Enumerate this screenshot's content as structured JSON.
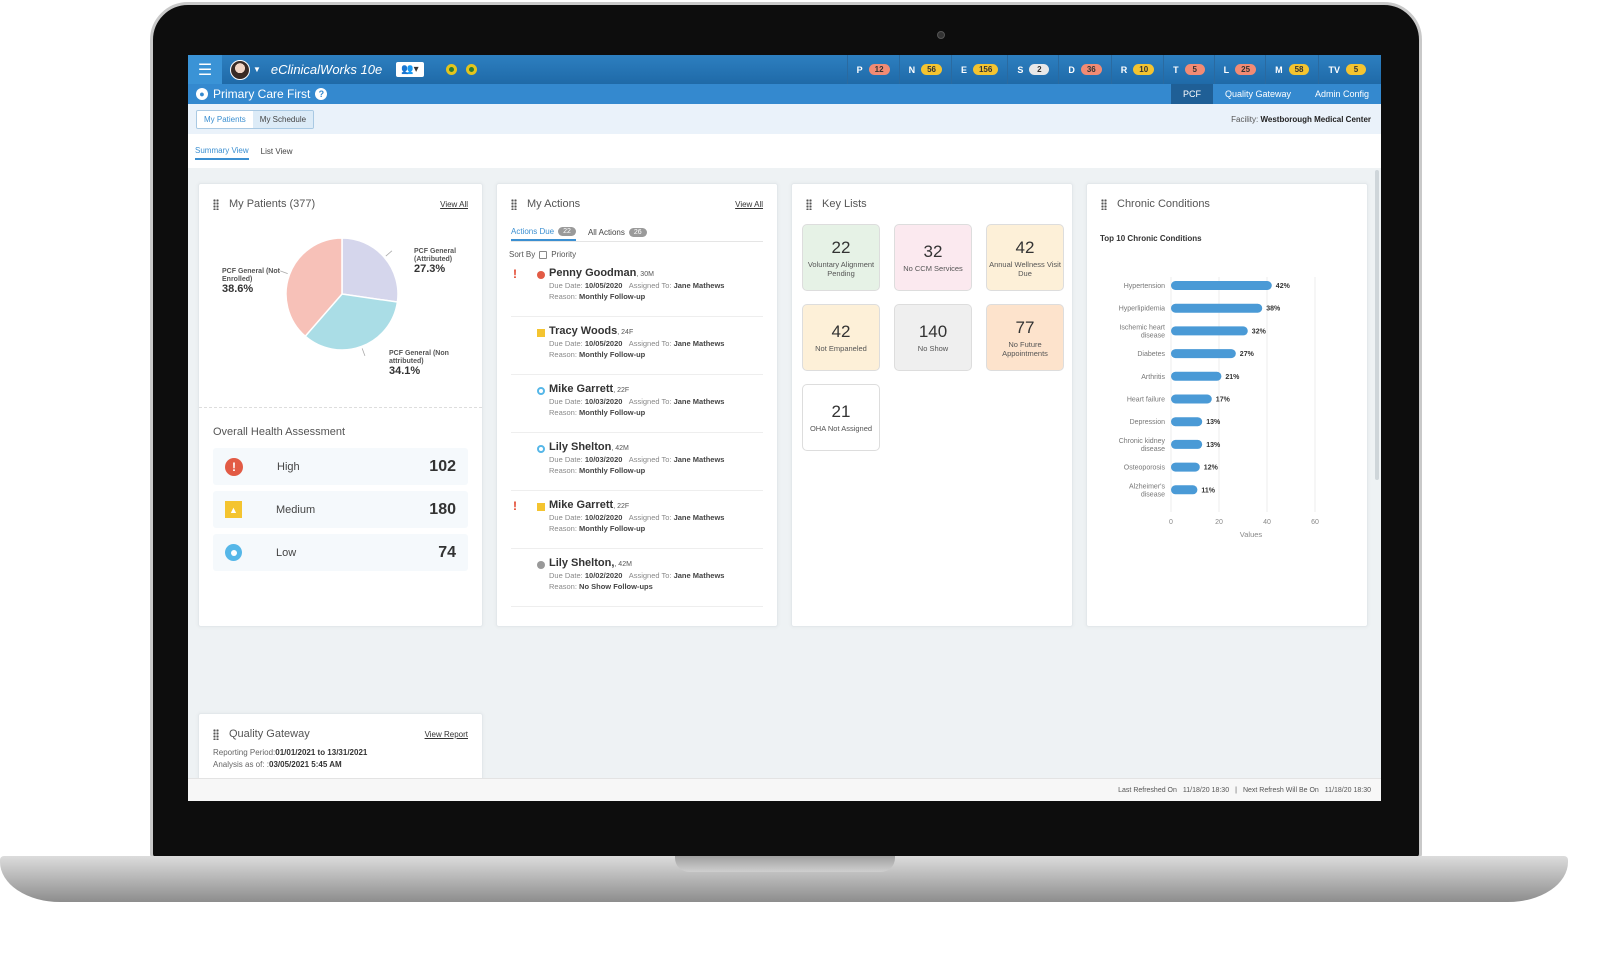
{
  "topbar": {
    "app_title": "eClinicalWorks 10e",
    "counters": [
      {
        "letter": "P",
        "value": "12",
        "color": "#f28b74"
      },
      {
        "letter": "N",
        "value": "56",
        "color": "#f4c430"
      },
      {
        "letter": "E",
        "value": "156",
        "color": "#f4c430"
      },
      {
        "letter": "S",
        "value": "2",
        "color": "#e8e8e8"
      },
      {
        "letter": "D",
        "value": "36",
        "color": "#f28b74"
      },
      {
        "letter": "R",
        "value": "10",
        "color": "#f4c430"
      },
      {
        "letter": "T",
        "value": "5",
        "color": "#f28b74"
      },
      {
        "letter": "L",
        "value": "25",
        "color": "#f28b74"
      },
      {
        "letter": "M",
        "value": "58",
        "color": "#f4c430"
      },
      {
        "letter": "TV",
        "value": "5",
        "color": "#f4c430"
      }
    ]
  },
  "subbar": {
    "title": "Primary Care First",
    "nav": [
      "PCF",
      "Quality Gateway",
      "Admin Config"
    ]
  },
  "toolbar": {
    "tabs": [
      "My Patients",
      "My Schedule"
    ],
    "facility_label": "Facility:",
    "facility_value": "Westborough Medical Center"
  },
  "view_tabs": [
    "Summary View",
    "List View"
  ],
  "my_patients": {
    "title": "My Patients (377)",
    "view_all": "View All",
    "chart_data": {
      "type": "pie",
      "slices": [
        {
          "label": "PCF General (Attributed)",
          "value": 27.3,
          "pct_label": "27.3%",
          "color": "#d5d6ec"
        },
        {
          "label": "PCF General (Non attributed)",
          "value": 34.1,
          "pct_label": "34.1%",
          "color": "#aadde6"
        },
        {
          "label": "PCF General (Not Enrolled)",
          "value": 38.6,
          "pct_label": "38.6%",
          "color": "#f7c1b8"
        }
      ]
    },
    "oha_title": "Overall Health Assessment",
    "oha": [
      {
        "label": "High",
        "value": "102"
      },
      {
        "label": "Medium",
        "value": "180"
      },
      {
        "label": "Low",
        "value": "74"
      }
    ]
  },
  "my_actions": {
    "title": "My Actions",
    "view_all": "View All",
    "tab_due": "Actions Due",
    "tab_due_count": "22",
    "tab_all": "All Actions",
    "tab_all_count": "26",
    "sort_by": "Sort By",
    "sort_option": "Priority",
    "due_label": "Due Date:",
    "assigned_label": "Assigned To:",
    "reason_label": "Reason:",
    "items": [
      {
        "name": "Penny Goodman",
        "age": ", 30M",
        "due": "10/05/2020",
        "assigned": "Jane Mathews",
        "reason": "Monthly Follow-up",
        "priority": "high",
        "flag": "!"
      },
      {
        "name": "Tracy Woods",
        "age": ", 24F",
        "due": "10/05/2020",
        "assigned": "Jane Mathews",
        "reason": "Monthly Follow-up",
        "priority": "med",
        "flag": ""
      },
      {
        "name": "Mike Garrett",
        "age": ", 22F",
        "due": "10/03/2020",
        "assigned": "Jane Mathews",
        "reason": "Monthly Follow-up",
        "priority": "low",
        "flag": ""
      },
      {
        "name": "Lily Shelton",
        "age": ", 42M",
        "due": "10/03/2020",
        "assigned": "Jane Mathews",
        "reason": "Monthly Follow-up",
        "priority": "low",
        "flag": ""
      },
      {
        "name": "Mike Garrett",
        "age": ", 22F",
        "due": "10/02/2020",
        "assigned": "Jane Mathews",
        "reason": "Monthly Follow-up",
        "priority": "med",
        "flag": "!"
      },
      {
        "name": "Lily Shelton,",
        "age": ", 42M",
        "due": "10/02/2020",
        "assigned": "Jane Mathews",
        "reason": "No Show Follow-ups",
        "priority": "none",
        "flag": ""
      }
    ]
  },
  "key_lists": {
    "title": "Key Lists",
    "items": [
      {
        "value": "22",
        "label": "Voluntary Alignment Pending",
        "bg": "#e6f2e6"
      },
      {
        "value": "32",
        "label": "No CCM Services",
        "bg": "#fbe9ef"
      },
      {
        "value": "42",
        "label": "Annual Wellness Visit Due",
        "bg": "#fdf0d8"
      },
      {
        "value": "42",
        "label": "Not Empaneled",
        "bg": "#fdf0d8"
      },
      {
        "value": "140",
        "label": "No Show",
        "bg": "#efefef"
      },
      {
        "value": "77",
        "label": "No Future Appointments",
        "bg": "#fde3cc"
      },
      {
        "value": "21",
        "label": "OHA Not Assigned",
        "bg": "#ffffff"
      }
    ]
  },
  "chronic_conditions": {
    "title": "Chronic Conditions",
    "chart_data": {
      "type": "bar",
      "orientation": "horizontal",
      "title": "Top 10 Chronic Conditions",
      "xlabel": "Values",
      "xlim": [
        0,
        60
      ],
      "xticks": [
        "0",
        "20",
        "40",
        "60"
      ],
      "categories": [
        "Hypertension",
        "Hyperlipidemia",
        "Ischemic heart disease",
        "Diabetes",
        "Arthritis",
        "Heart failure",
        "Depression",
        "Chronic kidney disease",
        "Osteoporosis",
        "Alzheimer's disease"
      ],
      "values": [
        42,
        38,
        32,
        27,
        21,
        17,
        13,
        13,
        12,
        11
      ],
      "value_labels": [
        "42%",
        "38%",
        "32%",
        "27%",
        "21%",
        "17%",
        "13%",
        "13%",
        "12%",
        "11%"
      ],
      "color": "#4a9ad6"
    }
  },
  "quality_gateway": {
    "title": "Quality Gateway",
    "view_report": "View Report",
    "period_label": "Reporting Period:",
    "period_value": "01/01/2021 to 13/31/2021",
    "analysis_label": "Analysis as of: :",
    "analysis_value": "03/05/2021 5:45 AM"
  },
  "footer": {
    "last_label": "Last Refreshed On",
    "last_value": "11/18/20 18:30",
    "next_label": "Next Refresh Will Be On",
    "next_value": "11/18/20 18:30"
  }
}
